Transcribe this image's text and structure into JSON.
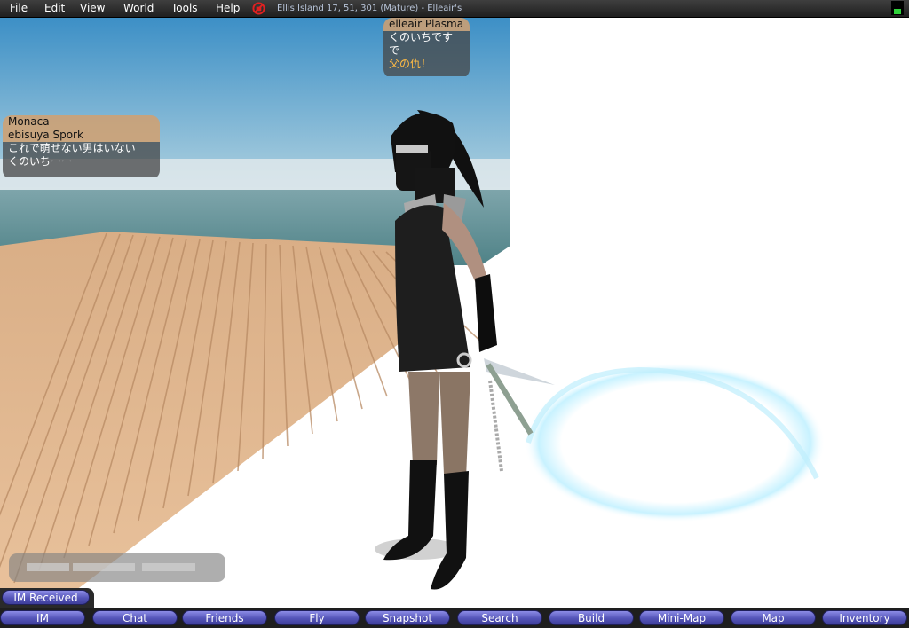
{
  "menu": {
    "items": [
      "File",
      "Edit",
      "View",
      "World",
      "Tools",
      "Help"
    ],
    "location": "Ellis Island 17, 51, 301 (Mature) - Elleair's"
  },
  "nametags": {
    "top": {
      "name": "elleair Plasma",
      "lines": [
        "くのいちです",
        "で"
      ],
      "highlight": "父の仇！"
    },
    "left": {
      "name_lines": [
        "Monaca",
        "ebisuya Spork"
      ],
      "lines": [
        "これで萌せない男はいない",
        "くのいちーー"
      ]
    }
  },
  "im_received": {
    "label": "IM Received"
  },
  "toolbar": {
    "buttons": [
      "IM",
      "Chat",
      "Friends",
      "Fly",
      "Snapshot",
      "Search",
      "Build",
      "Mini-Map",
      "Map",
      "Inventory"
    ]
  },
  "colors": {
    "sky_top": "#3c8fc6",
    "sea": "#5d8f95",
    "deck": "#e2b68d",
    "toolbar_button": "#6262c8",
    "name_bg": "#d2a06e"
  }
}
